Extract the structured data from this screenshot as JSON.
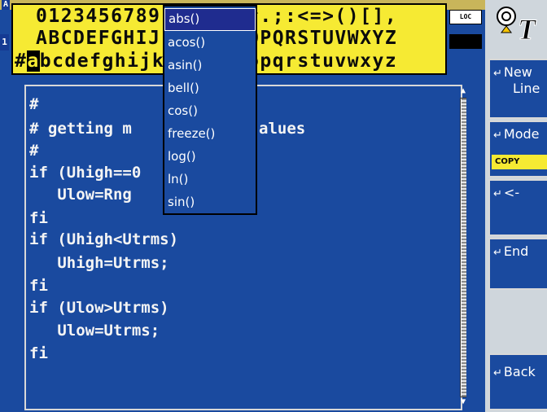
{
  "status": {
    "indicator_a": "A",
    "indicator_1": "1",
    "loc_badge": "LOC"
  },
  "keyboard": {
    "row0_left": "0123456789",
    "row0_right": "^.;:<=>()[],",
    "row1_left": "ABCDEFGHIJ",
    "row1_right": "OPQRSTUVWXYZ",
    "row2_prefix": "#",
    "row2_selected": "a",
    "row2_left": "bcdefghijk",
    "row2_right": "opqrstuvwxyz"
  },
  "editor": {
    "lines": [
      "#",
      "# getting m",
      "#",
      "if (Uhigh==0",
      "   Ulow=Rng",
      "fi",
      "if (Uhigh<Utrms)",
      "   Uhigh=Utrms;",
      "fi",
      "if (Ulow>Utrms)",
      "   Ulow=Utrms;",
      "fi"
    ],
    "line1_tail": "alues"
  },
  "function_menu": {
    "items": [
      "abs()",
      "acos()",
      "asin()",
      "bell()",
      "cos()",
      "freeze()",
      "log()",
      "ln()",
      "sin()"
    ],
    "selected_index": 0
  },
  "softkeys": {
    "new_line_1": "New",
    "new_line_2": "Line",
    "mode": "Mode",
    "mode_value": "COPY",
    "back_arrow": "<-",
    "end": "End",
    "back": "Back",
    "return_glyph": "↵"
  },
  "icons": {
    "top_right": "text-tool-icon"
  },
  "colors": {
    "screen_blue": "#1a4a9f",
    "keyboard_yellow": "#f6ea33",
    "softkey_panel": "#cfd6dc"
  }
}
